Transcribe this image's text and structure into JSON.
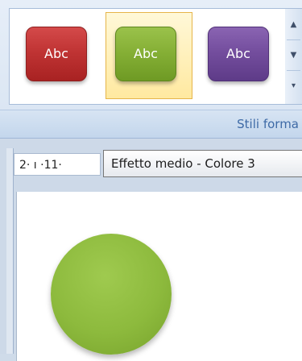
{
  "ribbon": {
    "gallery": {
      "styles": [
        {
          "label": "Abc",
          "color": "#c03434",
          "selected": false
        },
        {
          "label": "Abc",
          "color": "#86b036",
          "selected": true
        },
        {
          "label": "Abc",
          "color": "#744e9e",
          "selected": false
        }
      ],
      "scroll_up_icon": "▲",
      "scroll_down_icon": "▼",
      "more_icon": "▾"
    },
    "group_label": "Stili forma"
  },
  "workspace": {
    "ruler_text": "2· ı ·11·",
    "tooltip": "Effetto medio - Colore 3",
    "shape": {
      "type": "circle",
      "color": "#86b036"
    }
  }
}
